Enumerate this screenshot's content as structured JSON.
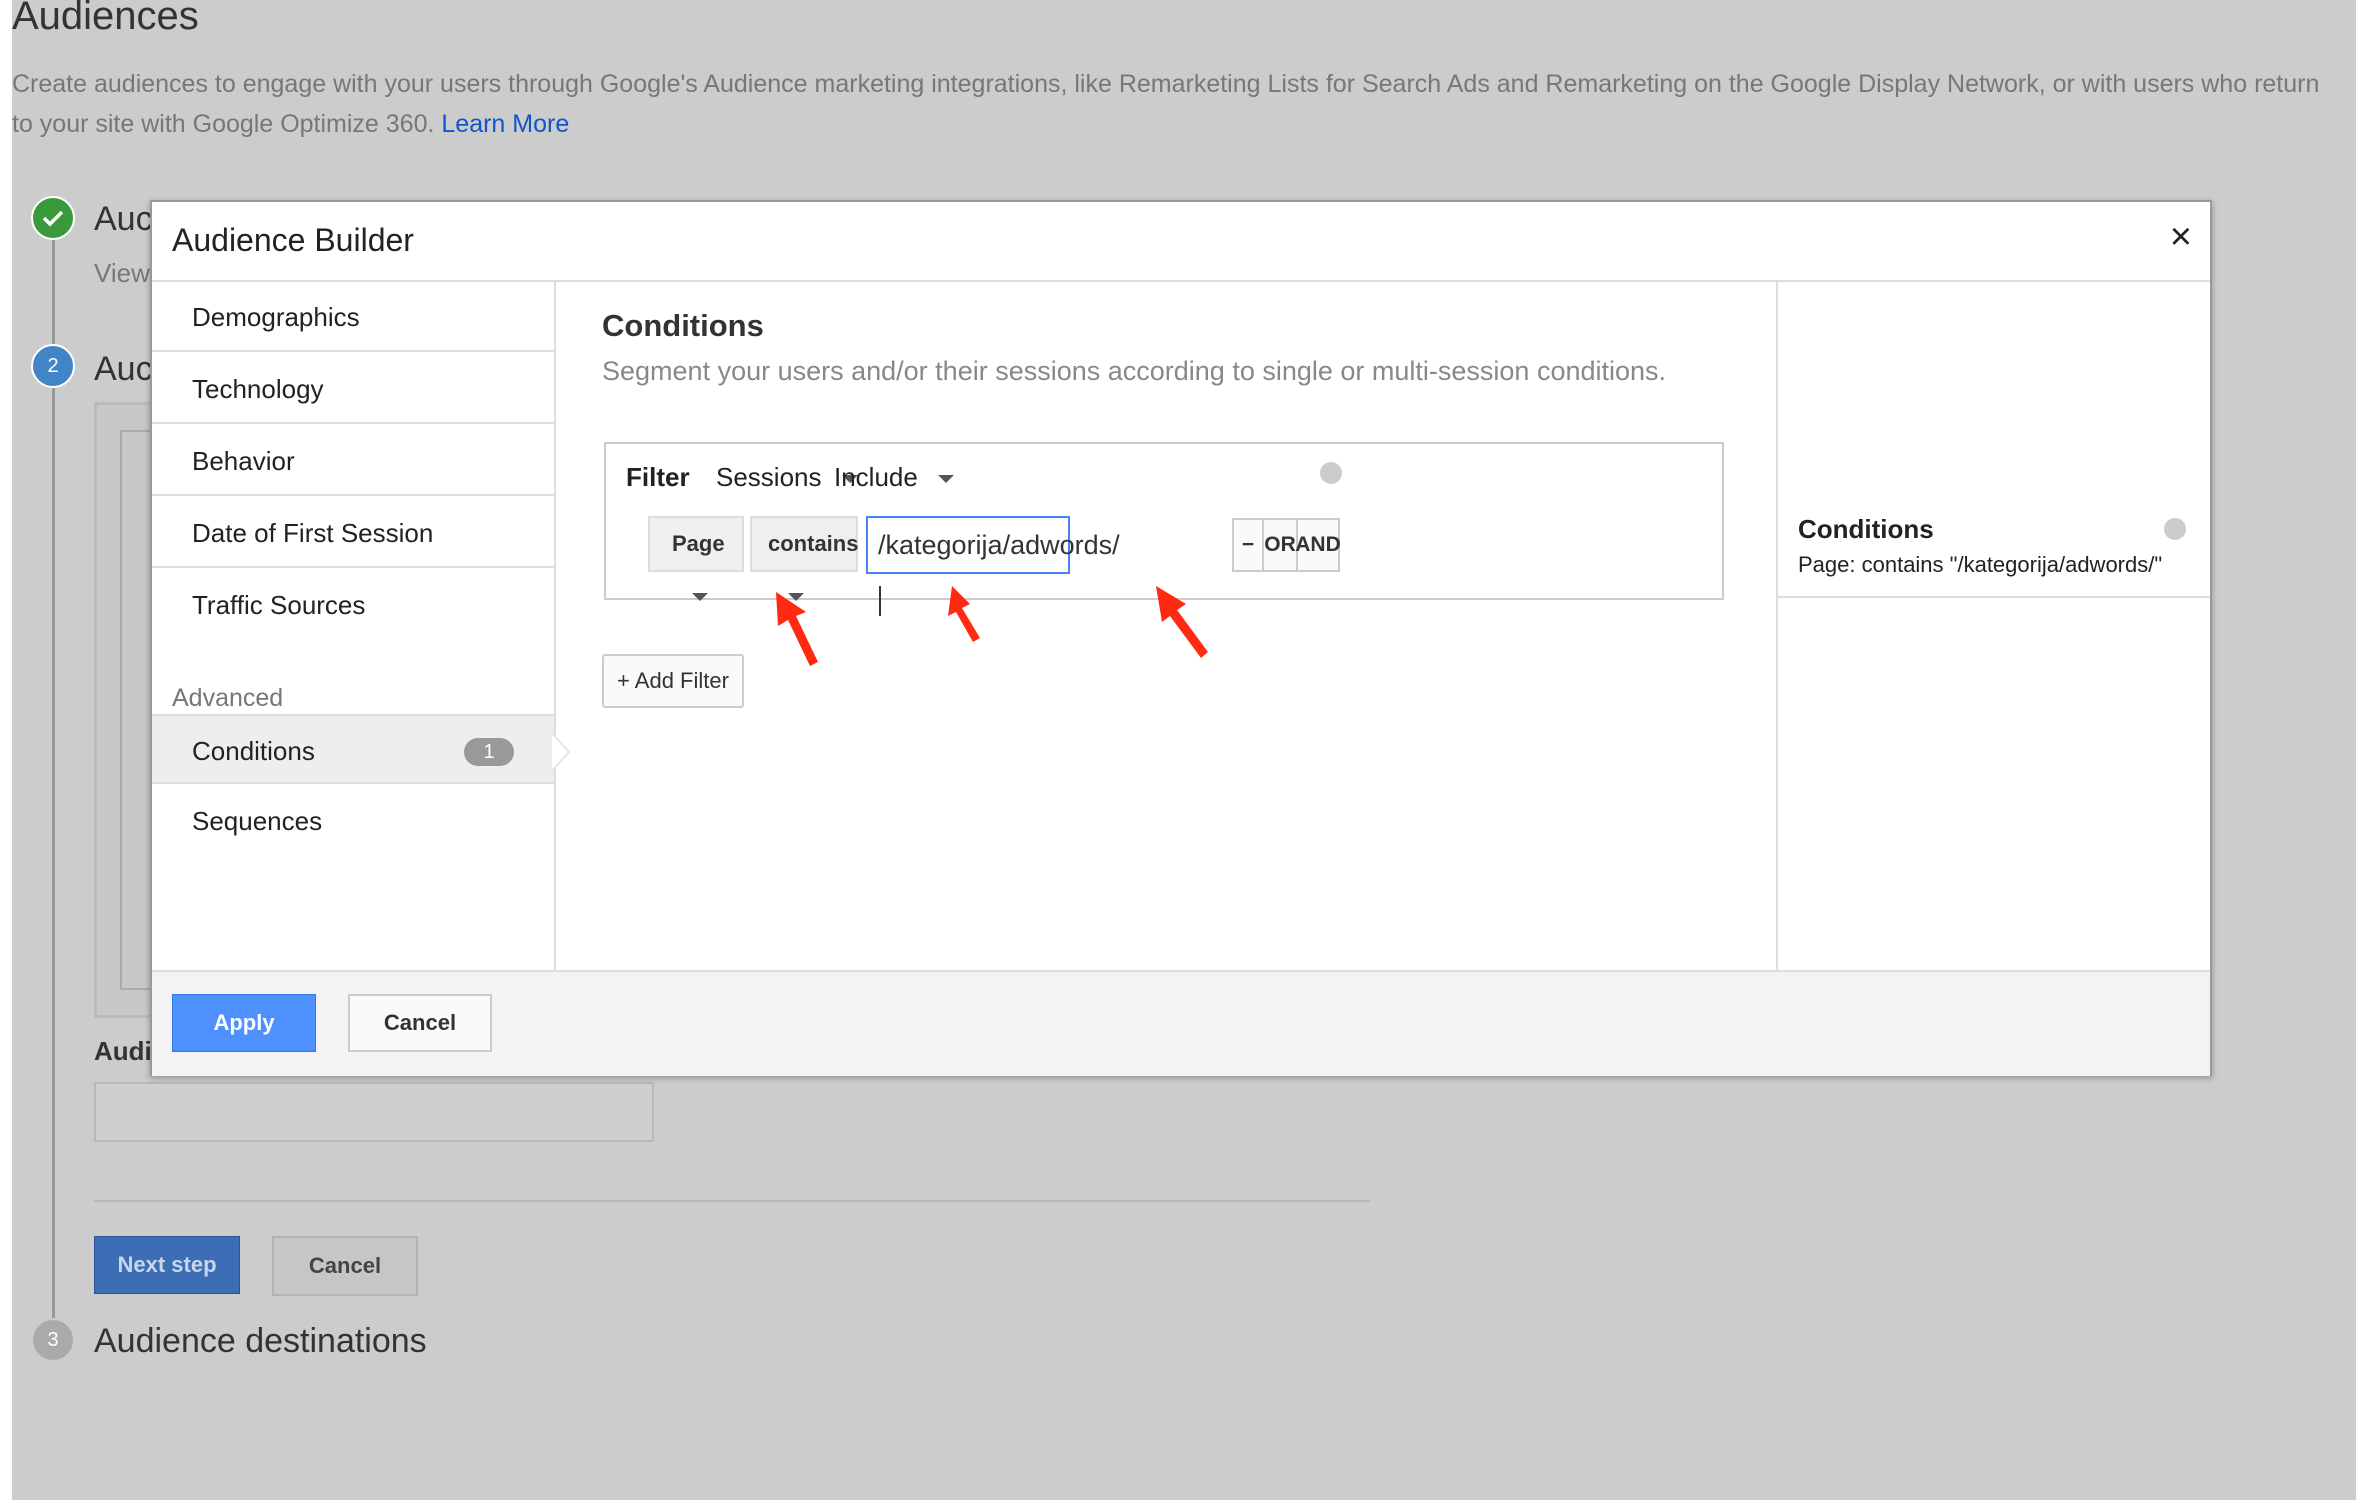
{
  "page": {
    "title": "Audiences",
    "description": "Create audiences to engage with your users through Google's Audience marketing integrations, like Remarketing Lists for Search Ads and Remarketing on the Google Display Network, or with users who return to your site with Google Optimize 360.",
    "learn_more": "Learn More"
  },
  "steps": {
    "step1_title": "Auc",
    "step1_sub": "View",
    "step2_number": "2",
    "step2_title": "Auc",
    "step3_number": "3",
    "step3_title": "Audience destinations",
    "audience_label": "Audi",
    "next_label": "Next step",
    "cancel_label": "Cancel"
  },
  "modal": {
    "title": "Audience Builder",
    "close_glyph": "×",
    "sidebar": {
      "items": [
        {
          "label": "Demographics"
        },
        {
          "label": "Technology"
        },
        {
          "label": "Behavior"
        },
        {
          "label": "Date of First Session"
        },
        {
          "label": "Traffic Sources"
        }
      ],
      "advanced_label": "Advanced",
      "advanced_items": [
        {
          "label": "Conditions",
          "badge": "1"
        },
        {
          "label": "Sequences"
        }
      ]
    },
    "conditions": {
      "title": "Conditions",
      "description": "Segment your users and/or their sessions according to single or multi-session conditions.",
      "filter_label": "Filter",
      "scope": "Sessions",
      "mode": "Include",
      "dimension": "Page",
      "operator": "contains",
      "value": "/kategorija/adwords/",
      "minus_label": "−",
      "or_label": "OR",
      "and_label": "AND",
      "add_filter_label": "+ Add Filter"
    },
    "summary": {
      "title": "Conditions",
      "text": "Page: contains \"/kategorija/adwords/\""
    },
    "footer": {
      "apply_label": "Apply",
      "cancel_label": "Cancel"
    }
  },
  "colors": {
    "accent_blue": "#4d90fe",
    "annotation_arrow": "#ff2a12"
  }
}
